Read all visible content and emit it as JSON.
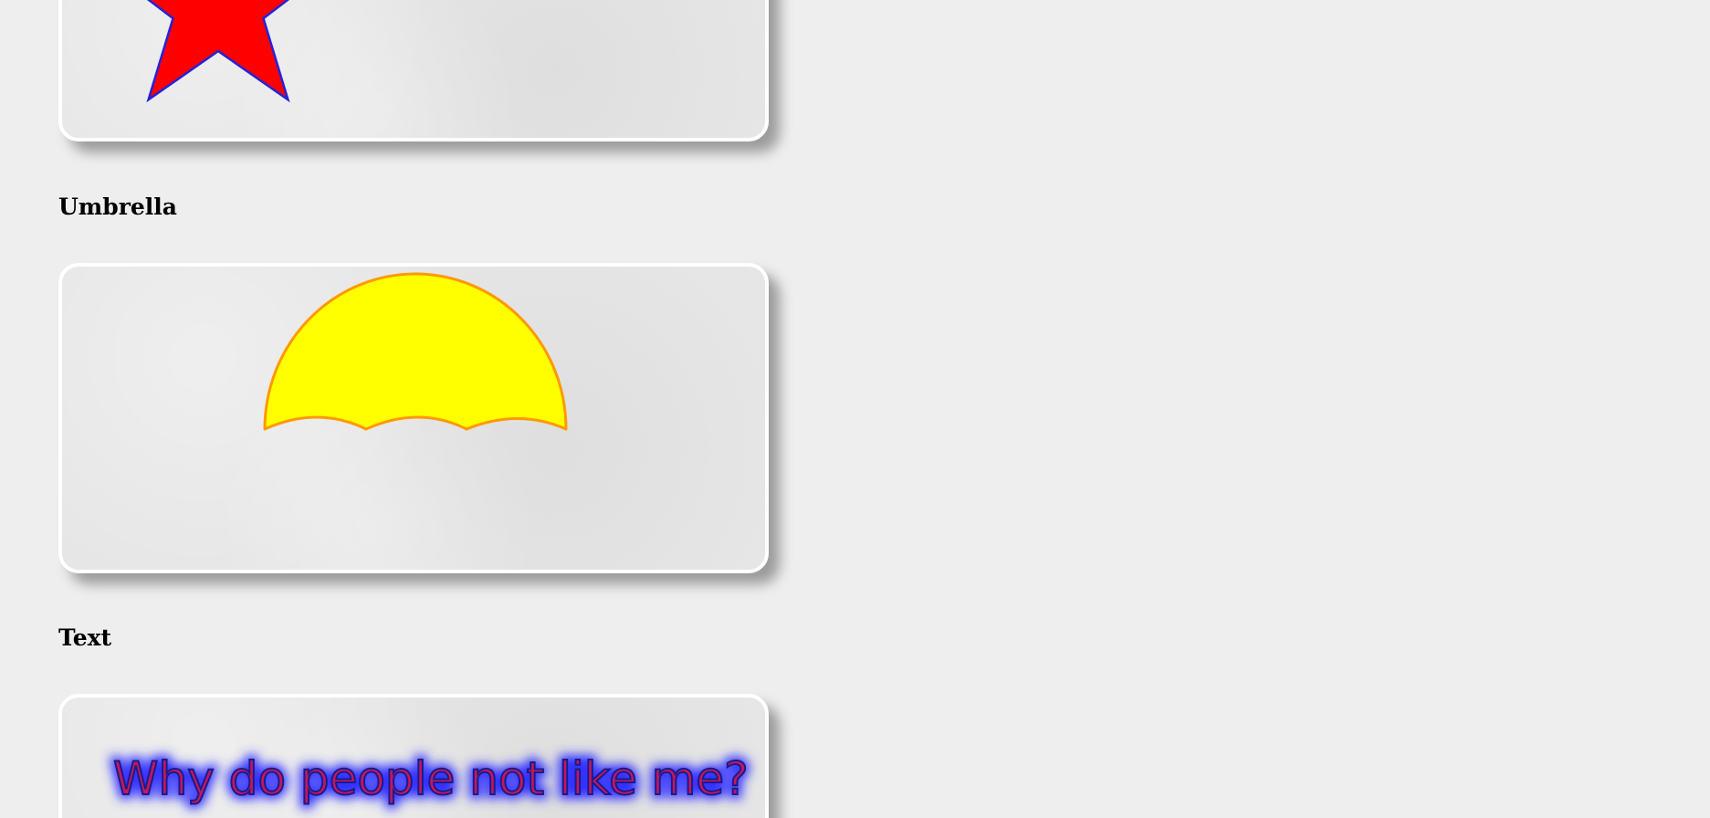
{
  "sections": [
    {
      "heading": ""
    },
    {
      "heading": "Umbrella"
    },
    {
      "heading": "Text"
    }
  ],
  "star": {
    "fill": "#ff0000",
    "stroke": "#2222dd"
  },
  "umbrella": {
    "fill": "#ffff00",
    "stroke": "#ff9900"
  },
  "text_demo": {
    "text": "Why do people not like me?",
    "fill": "#c4175a",
    "stroke": "#1a1a8c",
    "glow": "#3333ff"
  },
  "colors": {
    "page_background": "#eeeeee",
    "card_background": "#e6e6e6",
    "card_border": "#ffffff"
  }
}
